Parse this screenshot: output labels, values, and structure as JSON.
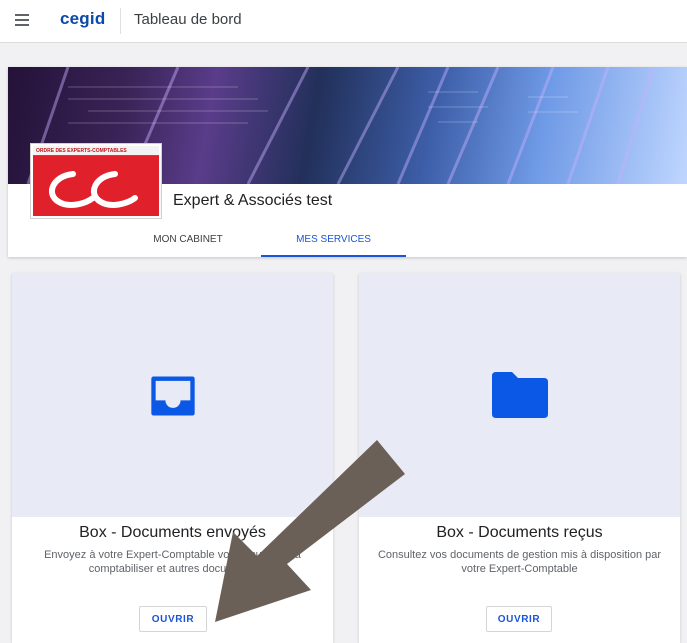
{
  "topbar": {
    "brand": "cegid",
    "page_title": "Tableau de bord"
  },
  "header": {
    "logo_band_text": "ORDRE DES EXPERTS-COMPTABLES",
    "company_name": "Expert & Associés test",
    "tabs": [
      {
        "label": "MON CABINET",
        "active": false
      },
      {
        "label": "MES SERVICES",
        "active": true
      }
    ]
  },
  "cards": [
    {
      "icon": "inbox-tray-icon",
      "title": "Box - Documents envoyés",
      "description": "Envoyez à votre Expert-Comptable vos documents à comptabiliser et autres documents",
      "button": "OUVRIR"
    },
    {
      "icon": "folder-icon",
      "title": "Box - Documents reçus",
      "description": "Consultez vos documents de gestion mis à disposition par votre Expert-Comptable",
      "button": "OUVRIR"
    }
  ],
  "colors": {
    "brand": "#0a4aa8",
    "accent": "#1a55d6",
    "icon": "#0b57e6",
    "media_bg": "#e8eaf5",
    "arrow": "#6b6057"
  }
}
